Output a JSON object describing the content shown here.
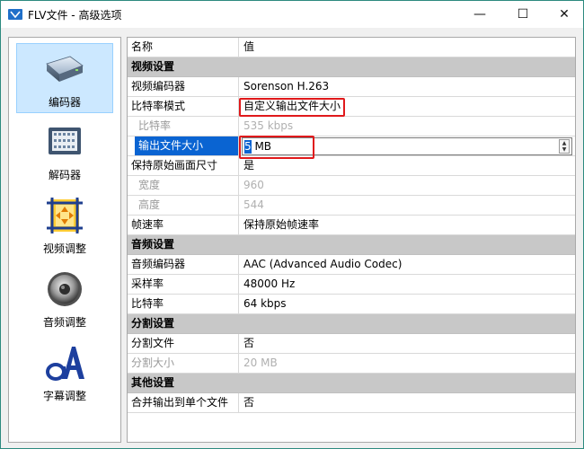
{
  "window": {
    "title": "FLV文件 - 高级选项",
    "controls": {
      "minimize": "—",
      "maximize": "☐",
      "close": "✕"
    }
  },
  "sidebar": {
    "items": [
      {
        "label": "编码器",
        "icon": "encoder-drive-icon",
        "selected": true
      },
      {
        "label": "解码器",
        "icon": "decoder-chip-icon",
        "selected": false
      },
      {
        "label": "视频调整",
        "icon": "video-adjust-icon",
        "selected": false
      },
      {
        "label": "音频调整",
        "icon": "speaker-icon",
        "selected": false
      },
      {
        "label": "字幕调整",
        "icon": "subtitle-font-icon",
        "selected": false
      }
    ]
  },
  "grid": {
    "header": {
      "name": "名称",
      "value": "值"
    },
    "rows": [
      {
        "type": "category",
        "label": "视频设置"
      },
      {
        "type": "prop",
        "name": "视频编码器",
        "value": "Sorenson H.263"
      },
      {
        "type": "prop",
        "name": "比特率模式",
        "value": "自定义输出文件大小"
      },
      {
        "type": "prop",
        "name": "比特率",
        "value": "535 kbps",
        "disabled": true
      },
      {
        "type": "edit",
        "name": "输出文件大小",
        "value_first": "5",
        "value_rest": " MB"
      },
      {
        "type": "prop",
        "name": "保持原始画面尺寸",
        "value": "是"
      },
      {
        "type": "prop",
        "name": "宽度",
        "value": "960",
        "disabled": true
      },
      {
        "type": "prop",
        "name": "高度",
        "value": "544",
        "disabled": true
      },
      {
        "type": "prop",
        "name": "帧速率",
        "value": "保持原始帧速率"
      },
      {
        "type": "category",
        "label": "音频设置"
      },
      {
        "type": "prop",
        "name": "音频编码器",
        "value": "AAC (Advanced Audio Codec)"
      },
      {
        "type": "prop",
        "name": "采样率",
        "value": "48000 Hz"
      },
      {
        "type": "prop",
        "name": "比特率",
        "value": "64 kbps"
      },
      {
        "type": "category",
        "label": "分割设置"
      },
      {
        "type": "prop",
        "name": "分割文件",
        "value": "否"
      },
      {
        "type": "prop",
        "name": "分割大小",
        "value": "20 MB",
        "disabled": true
      },
      {
        "type": "category",
        "label": "其他设置"
      },
      {
        "type": "prop",
        "name": "合并输出到单个文件",
        "value": "否"
      }
    ]
  },
  "colors": {
    "selection": "#0a64d2",
    "highlight_border": "#e0191b",
    "category_bg": "#c8c8c8"
  }
}
